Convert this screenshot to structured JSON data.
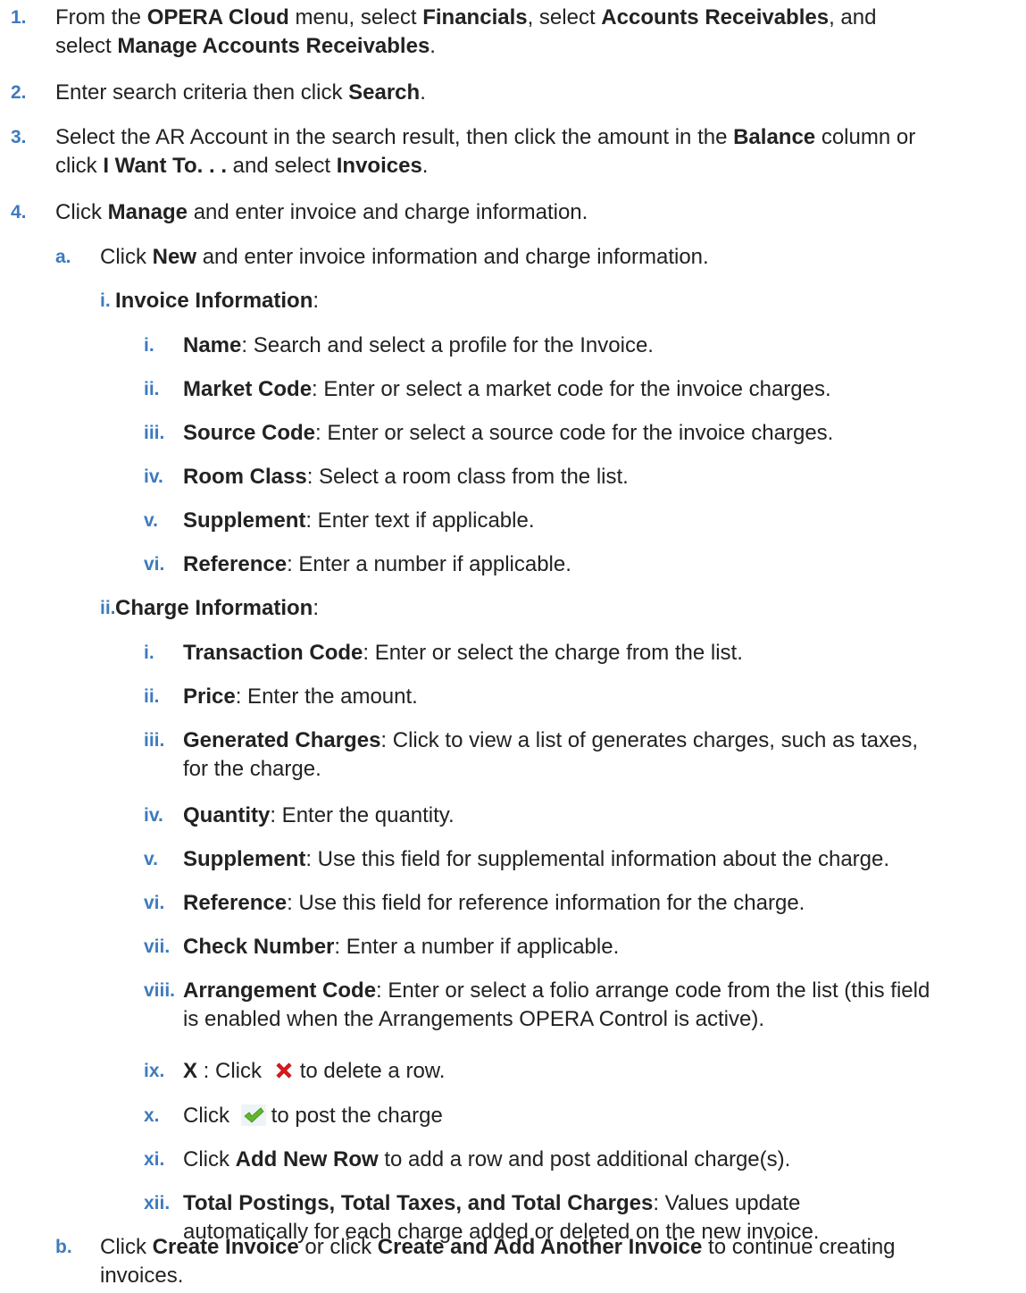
{
  "steps": {
    "s1": {
      "num": "1.",
      "a": "From the ",
      "b": "OPERA Cloud",
      "c": " menu, select ",
      "d": "Financials",
      "e": ", select ",
      "f": "Accounts Receivables",
      "g": ", and",
      "h": "select ",
      "i": "Manage Accounts Receivables",
      "j": "."
    },
    "s2": {
      "num": "2.",
      "a": "Enter search criteria then click ",
      "b": "Search",
      "c": "."
    },
    "s3": {
      "num": "3.",
      "a": "Select the AR Account in the search result, then click the amount in the ",
      "b": "Balance",
      "c": " column or",
      "d": "click ",
      "e": "I Want To. . .",
      "f": " and select ",
      "g": "Invoices",
      "h": "."
    },
    "s4": {
      "num": "4.",
      "a": "Click ",
      "b": "Manage",
      "c": " and enter invoice and charge information."
    },
    "s4a": {
      "num": "a.",
      "a": "Click ",
      "b": "New",
      "c": " and enter invoice information and charge information."
    },
    "inv": {
      "num": "i.",
      "label": "Invoice Information",
      "colon": ":"
    },
    "inv_items": [
      {
        "num": "i.",
        "label": "Name",
        "text": ": Search and select a profile for the Invoice."
      },
      {
        "num": "ii.",
        "label": "Market Code",
        "text": ": Enter or select a market code for the invoice charges."
      },
      {
        "num": "iii.",
        "label": "Source Code",
        "text": ": Enter or select a source code for the invoice charges."
      },
      {
        "num": "iv.",
        "label": "Room Class",
        "text": ": Select a room class from the list."
      },
      {
        "num": "v.",
        "label": "Supplement",
        "text": ": Enter text if applicable."
      },
      {
        "num": "vi.",
        "label": "Reference",
        "text": ": Enter a number if applicable."
      }
    ],
    "chg": {
      "num": "ii.",
      "label": "Charge Information",
      "colon": ":"
    },
    "chg_items": [
      {
        "num": "i.",
        "label": "Transaction Code",
        "text": ": Enter or select the charge from the list."
      },
      {
        "num": "ii.",
        "label": "Price",
        "text": ": Enter the amount."
      },
      {
        "num": "iii.",
        "label": "Generated Charges",
        "text": ": Click to view a list of generates charges, such as taxes,",
        "text2": "for the charge."
      },
      {
        "num": "iv.",
        "label": "Quantity",
        "text": ": Enter the quantity."
      },
      {
        "num": "v.",
        "label": "Supplement",
        "text": ": Use this field for supplemental information about the charge."
      },
      {
        "num": "vi.",
        "label": "Reference",
        "text": ": Use this field for reference information for the charge."
      },
      {
        "num": "vii.",
        "label": "Check Number",
        "text": ": Enter a number if applicable."
      },
      {
        "num": "viii.",
        "label": "Arrangement Code",
        "text": ": Enter or select a folio arrange code from the list (this field",
        "text2": "is enabled when the Arrangements OPERA Control is active)."
      }
    ],
    "chg_ix": {
      "num": "ix.",
      "label": "X",
      "a": " : Click",
      "b": "to delete a row."
    },
    "chg_x": {
      "num": "x.",
      "a": "Click",
      "b": "to post the charge"
    },
    "chg_xi": {
      "num": "xi.",
      "a": "Click ",
      "b": "Add New Row",
      "c": " to add a row and post additional charge(s)."
    },
    "chg_xii": {
      "num": "xii.",
      "label": "Total Postings, Total Taxes, and Total Charges",
      "text": ": Values update",
      "text2": "automatically for each charge added or deleted on the new invoice."
    },
    "s4b": {
      "num": "b.",
      "a": "Click ",
      "b": "Create Invoice",
      "c": " or click ",
      "d": "Create and Add Another Invoice",
      "e": " to continue creating",
      "f": "invoices."
    }
  },
  "icons": {
    "delete": "red-x-icon",
    "post": "green-checkmark-icon"
  },
  "colors": {
    "number": "#3d7bbf",
    "text": "#222222",
    "delete_icon": "#e0191b",
    "post_icon": "#5fb72c"
  }
}
